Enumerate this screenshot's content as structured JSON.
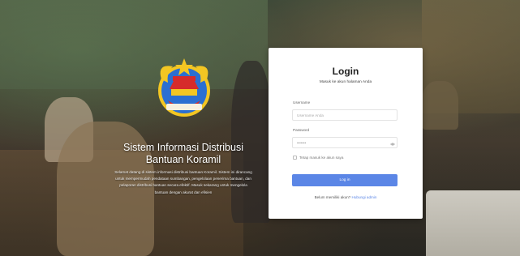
{
  "app": {
    "name": "Sistem Informasi Distribusi Bantuan Koramil",
    "description": "Selamat datang di sistem informasi distribusi bantuan Koramil. Sistem ini dirancang untuk mempermudah pendataan sumbangan, pengelolaan penerima bantuan, dan pelaporan distribusi bantuan secara efektif. Masuk sekarang untuk mengelola bantuan dengan akurat dan efisien"
  },
  "login": {
    "title": "Login",
    "subtitle": "Masuk ke akun halaman Anda",
    "username_label": "Username",
    "username_placeholder": "Username Anda",
    "password_label": "Password",
    "password_value": "•••••••",
    "remember_label": "Tetap masuk ke akun saya",
    "submit_label": "Log in",
    "register_prompt": "Belum memiliki akun?",
    "register_link": "Hubungi admin"
  },
  "colors": {
    "accent": "#5b86e6",
    "card_bg": "#ffffff"
  },
  "icons": {
    "password_toggle": "eye-icon",
    "logo": "koramil-emblem"
  }
}
